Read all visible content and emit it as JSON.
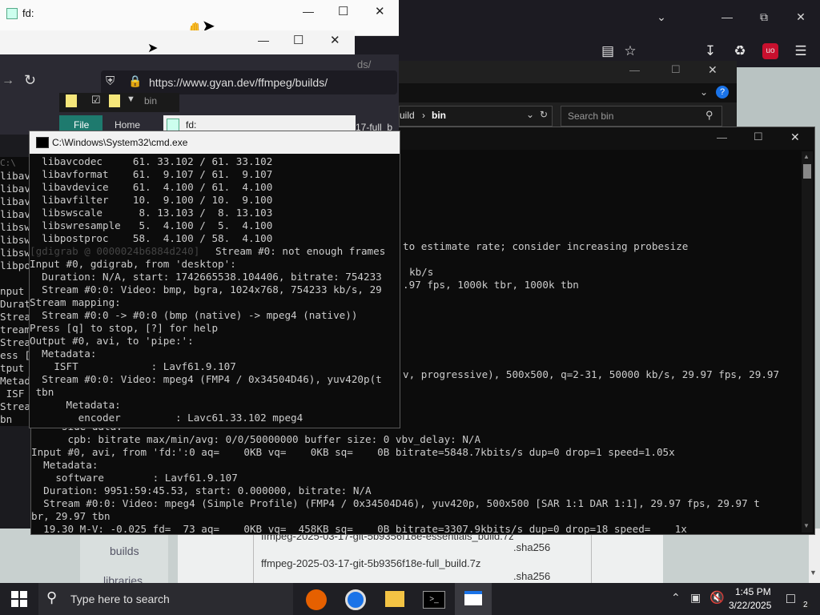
{
  "fd1": {
    "title": "fd:"
  },
  "fd2": {
    "title": ""
  },
  "browser": {
    "url": "https://www.gyan.dev/ffmpeg/builds/",
    "tab_fragment": "ds/"
  },
  "explorer": {
    "breadcrumb_1": "uild",
    "breadcrumb_2": "bin",
    "search_placeholder": "Search bin",
    "ribbon_folder": "bin",
    "ribbon_file": "File",
    "ribbon_home": "Home",
    "window_fragment": "fd:",
    "side_fragment": "17-full_b"
  },
  "cmd_small": {
    "title": "C:\\Windows\\System32\\cmd.exe",
    "lines": [
      "  libavcodec     61. 33.102 / 61. 33.102",
      "  libavformat    61.  9.107 / 61.  9.107",
      "  libavdevice    61.  4.100 / 61.  4.100",
      "  libavfilter    10.  9.100 / 10.  9.100",
      "  libswscale      8. 13.103 /  8. 13.103",
      "  libswresample   5.  4.100 /  5.  4.100",
      "  libpostproc    58.  4.100 / 58.  4.100",
      "Stream #0: not enough frames",
      "Input #0, gdigrab, from 'desktop':",
      "  Duration: N/A, start: 1742665538.104406, bitrate: 754233",
      "  Stream #0:0: Video: bmp, bgra, 1024x768, 754233 kb/s, 29",
      "Stream mapping:",
      "  Stream #0:0 -> #0:0 (bmp (native) -> mpeg4 (native))",
      "Press [q] to stop, [?] for help",
      "Output #0, avi, to 'pipe:':",
      "  Metadata:",
      "    ISFT            : Lavf61.9.107",
      "  Stream #0:0: Video: mpeg4 (FMP4 / 0x34504D46), yuv420p(t",
      " tbn",
      "      Metadata:",
      "        encoder         : Lavc61.33.102 mpeg4"
    ],
    "gdigrab_tag": "[gdigrab @ 0000024b6884d240]"
  },
  "cmd_big": {
    "right_lines": [
      "to estimate rate; consider increasing probesize",
      "kb/s",
      ".97 fps, 1000k tbr, 1000k tbn",
      "v, progressive), 500x500, q=2-31, 50000 kb/s, 29.97 fps, 29.97"
    ],
    "bottom_lines": [
      "     side data:",
      "      cpb: bitrate max/min/avg: 0/0/50000000 buffer size: 0 vbv_delay: N/A",
      "Input #0, avi, from 'fd:':0 aq=    0KB vq=    0KB sq=    0B bitrate=5848.7kbits/s dup=0 drop=1 speed=1.05x",
      "  Metadata:",
      "    software        : Lavf61.9.107",
      "  Duration: 9951:59:45.53, start: 0.000000, bitrate: N/A",
      "  Stream #0:0: Video: mpeg4 (Simple Profile) (FMP4 / 0x34504D46), yuv420p, 500x500 [SAR 1:1 DAR 1:1], 29.97 fps, 29.97 t",
      "br, 29.97 tbn",
      "  19.30 M-V: -0.025 fd=  73 aq=    0KB vq=  458KB sq=    0B bitrate=3307.9kbits/s dup=0 drop=18 speed=    1x"
    ]
  },
  "cmd_left": {
    "lines": [
      "C:\\",
      "libav",
      "libav",
      "libav",
      "libav",
      "libsw",
      "libsw",
      "libsw",
      "libpo",
      "",
      "nput #",
      "Durat",
      "Strea",
      "tream",
      "Strea",
      "ess [",
      "tput",
      "Metad",
      " ISF",
      "Strea",
      "bn"
    ]
  },
  "page_files": {
    "file1": "ffmpeg-2025-03-17-git-5b9356f18e-essentials_build.7z",
    "file1_hash": ".sha256",
    "file2": "ffmpeg-2025-03-17-git-5b9356f18e-full_build.7z",
    "file2_hash": ".sha256",
    "nav_builds": "builds",
    "nav_libraries": "libraries"
  },
  "taskbar": {
    "search_placeholder": "Type here to search",
    "time": "1:45 PM",
    "date": "3/22/2025",
    "notification_count": "2"
  }
}
